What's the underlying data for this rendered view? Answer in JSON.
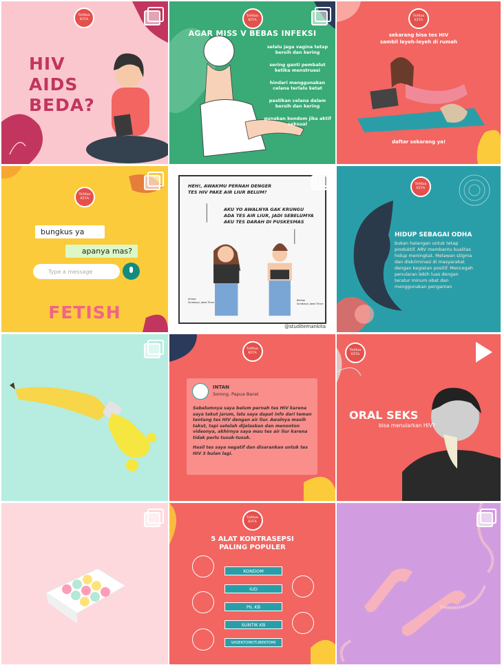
{
  "logo": {
    "line1": "TeMan",
    "line2": "KITA"
  },
  "tiles": {
    "t1": {
      "title_lines": [
        "HIV",
        "AIDS",
        "BEDA?"
      ],
      "colors": {
        "bg": "#fbc7cf",
        "title": "#c2355e"
      }
    },
    "t2": {
      "title": "AGAR MISS V BEBAS INFEKSI",
      "items": [
        "selalu jaga vagina tetap bersih dan kering",
        "sering ganti pembalut ketika menstruasi",
        "hindari menggunakan celana terlalu ketat",
        "pastikan celana dalam bersih dan kering",
        "gunakan kondom jika aktif seksual"
      ],
      "colors": {
        "bg": "#3aaa77"
      }
    },
    "t3": {
      "text_lines": [
        "sekarang bisa tes HIV",
        "sambil leyeh-leyeh di rumah"
      ],
      "cta": "daftar sekarang ya!",
      "colors": {
        "bg": "#f26561"
      }
    },
    "t4": {
      "bubble_in": "bungkus ya",
      "bubble_out": "apanya mas?",
      "input_placeholder": "Type a message",
      "title": "FETISH",
      "colors": {
        "bg": "#fbcb3b",
        "title": "#f06484"
      }
    },
    "t5": {
      "speech_1_lines": [
        "HEH!, AWAKMU PERNAH DENGER",
        "TES HIV PAKE AIR LIUR BELUM?"
      ],
      "speech_2_lines": [
        "AKU YO AWALNYA GAK KRUNGU",
        "ADA TES AIR LIUR, JADI SEBELUMYA",
        "AKU TES DARAH DI PUSKESMAS"
      ],
      "caption_left": [
        "Anissa",
        "Surabaya, Jawa Timur"
      ],
      "caption_right": [
        "Berlian",
        "Surabaya, Jawa Timur"
      ],
      "credit": "@studitemankita"
    },
    "t6": {
      "title": "HIDUP SEBAGAI ODHA",
      "body_lines": [
        "bukan halangan untuk tetap",
        "produktif. ARV membantu kualitas",
        "hidup meningkat. Melawan stigma",
        "dan diskriminasi di masyarakat",
        "dengan kegiatan positif. Mencegah",
        "penularan lebih luas dengan",
        "teratur minum obat dan",
        "menggunakan pengaman"
      ],
      "colors": {
        "bg": "#2a9ea8"
      }
    },
    "t7": {
      "colors": {
        "bg": "#b6ede0"
      }
    },
    "t8": {
      "name": "INTAN",
      "location": "Sorong, Papua Barat",
      "body_p1": "Sebelumnya saya belum pernah tes HIV karena saya takut jarum, lalu saya dapat info dari teman tentang tes HIV dengan air liur. Awalnya masih takut, tapi setelah dijelaskan dan menonton videonya, akhirnya saya mau tes air liur karena tidak perlu tusuk-tusuk.",
      "body_p2": "Hasil tes saya negatif dan disarankan untuk tes HIV 3 bulan lagi.",
      "colors": {
        "bg": "#f26561"
      }
    },
    "t9": {
      "title": "ORAL SEKS",
      "subtitle": "bisa menularkan HIV?",
      "colors": {
        "bg": "#f26561"
      }
    },
    "t10": {
      "colors": {
        "bg": "#fdd9dd"
      }
    },
    "t11": {
      "title_lines": [
        "5 ALAT KONTRASEPSI",
        "PALING POPULER"
      ],
      "options": [
        "KONDOM",
        "IUD",
        "PIL KB",
        "SUNTIK KB",
        "VASEKTOMI/TUBEKTOMI"
      ],
      "colors": {
        "bg": "#f26561",
        "pill": "#2a9ea8"
      }
    },
    "t12": {
      "colors": {
        "bg": "#d29de0"
      }
    }
  }
}
